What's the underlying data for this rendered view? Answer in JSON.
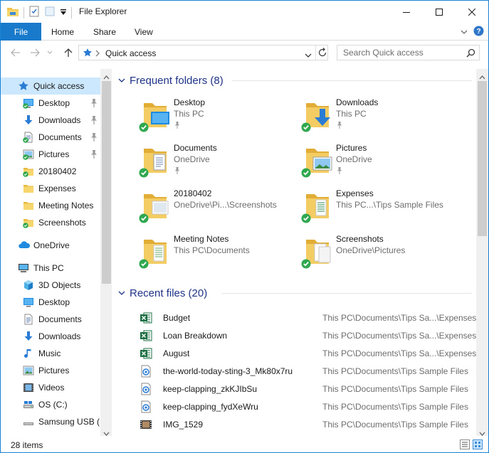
{
  "window": {
    "title": "File Explorer"
  },
  "ribbon": {
    "file": "File",
    "home": "Home",
    "share": "Share",
    "view": "View"
  },
  "address": {
    "crumb": "Quick access",
    "search_placeholder": "Search Quick access"
  },
  "nav": [
    {
      "label": "Quick access",
      "icon": "star-icon",
      "pinned": false,
      "selected": true,
      "indent": 0
    },
    {
      "label": "Desktop",
      "icon": "desktop-icon",
      "pinned": true,
      "indent": 1
    },
    {
      "label": "Downloads",
      "icon": "downloads-icon",
      "pinned": true,
      "indent": 1
    },
    {
      "label": "Documents",
      "icon": "documents-icon",
      "pinned": true,
      "indent": 1
    },
    {
      "label": "Pictures",
      "icon": "pictures-icon",
      "pinned": true,
      "indent": 1
    },
    {
      "label": "20180402",
      "icon": "folder-icon",
      "pinned": false,
      "indent": 1
    },
    {
      "label": "Expenses",
      "icon": "folder-icon",
      "pinned": false,
      "indent": 1
    },
    {
      "label": "Meeting Notes",
      "icon": "folder-icon",
      "pinned": false,
      "indent": 1
    },
    {
      "label": "Screenshots",
      "icon": "folder-icon",
      "pinned": false,
      "indent": 1
    },
    {
      "label": "OneDrive",
      "icon": "onedrive-icon",
      "pinned": false,
      "indent": 0
    },
    {
      "label": "This PC",
      "icon": "thispc-icon",
      "pinned": false,
      "indent": 0
    },
    {
      "label": "3D Objects",
      "icon": "3d-objects-icon",
      "pinned": false,
      "indent": 1
    },
    {
      "label": "Desktop",
      "icon": "desktop-icon",
      "pinned": false,
      "indent": 1
    },
    {
      "label": "Documents",
      "icon": "documents-icon",
      "pinned": false,
      "indent": 1
    },
    {
      "label": "Downloads",
      "icon": "downloads-icon",
      "pinned": false,
      "indent": 1
    },
    {
      "label": "Music",
      "icon": "music-icon",
      "pinned": false,
      "indent": 1
    },
    {
      "label": "Pictures",
      "icon": "pictures-icon",
      "pinned": false,
      "indent": 1
    },
    {
      "label": "Videos",
      "icon": "videos-icon",
      "pinned": false,
      "indent": 1
    },
    {
      "label": "OS (C:)",
      "icon": "drive-icon",
      "pinned": false,
      "indent": 1
    },
    {
      "label": "Samsung USB (E",
      "icon": "usb-drive-icon",
      "pinned": false,
      "indent": 1
    }
  ],
  "frequent": {
    "header": "Frequent folders (8)",
    "items": [
      {
        "name": "Desktop",
        "location": "This PC",
        "pinned": true,
        "icon": "desktop-folder-icon"
      },
      {
        "name": "Downloads",
        "location": "This PC",
        "pinned": true,
        "icon": "downloads-folder-icon"
      },
      {
        "name": "Documents",
        "location": "OneDrive",
        "pinned": true,
        "icon": "documents-folder-icon"
      },
      {
        "name": "Pictures",
        "location": "OneDrive",
        "pinned": true,
        "icon": "pictures-folder-icon"
      },
      {
        "name": "20180402",
        "location": "OneDrive\\Pi...\\Screenshots",
        "pinned": false,
        "icon": "folder-icon"
      },
      {
        "name": "Expenses",
        "location": "This PC...\\Tips Sample Files",
        "pinned": false,
        "icon": "folder-icon"
      },
      {
        "name": "Meeting Notes",
        "location": "This PC\\Documents",
        "pinned": false,
        "icon": "folder-icon"
      },
      {
        "name": "Screenshots",
        "location": "OneDrive\\Pictures",
        "pinned": false,
        "icon": "folder-icon"
      }
    ]
  },
  "recent": {
    "header": "Recent files (20)",
    "items": [
      {
        "name": "Budget",
        "path": "This PC\\Documents\\Tips Sa...\\Expenses",
        "icon": "excel-icon"
      },
      {
        "name": "Loan Breakdown",
        "path": "This PC\\Documents\\Tips Sa...\\Expenses",
        "icon": "excel-icon"
      },
      {
        "name": "August",
        "path": "This PC\\Documents\\Tips Sa...\\Expenses",
        "icon": "excel-icon"
      },
      {
        "name": "the-world-today-sting-3_Mk80x7ru",
        "path": "This PC\\Documents\\Tips Sample Files",
        "icon": "audio-file-icon"
      },
      {
        "name": "keep-clapping_zkKJIbSu",
        "path": "This PC\\Documents\\Tips Sample Files",
        "icon": "audio-file-icon"
      },
      {
        "name": "keep-clapping_fydXeWru",
        "path": "This PC\\Documents\\Tips Sample Files",
        "icon": "audio-file-icon"
      },
      {
        "name": "IMG_1529",
        "path": "This PC\\Documents\\Tips Sample Files",
        "icon": "video-file-icon"
      }
    ]
  },
  "status": {
    "count": "28 items"
  }
}
